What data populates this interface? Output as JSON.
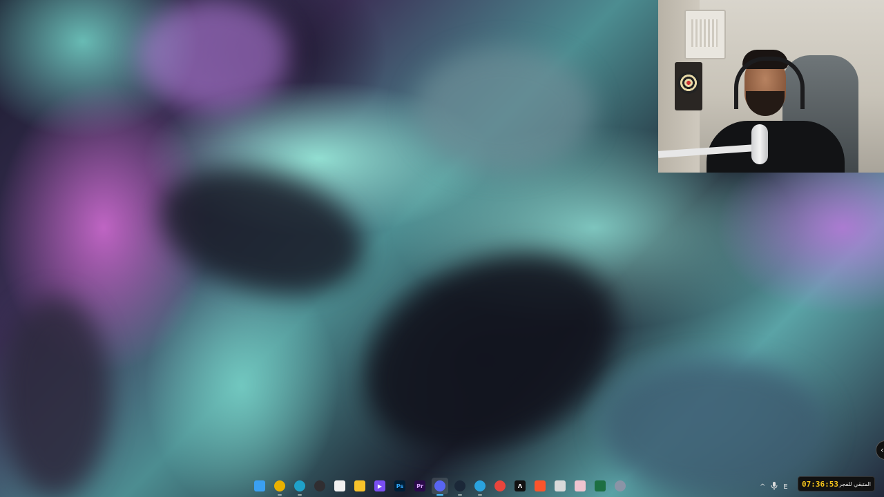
{
  "webcam": {
    "description_visible": false
  },
  "taskbar": {
    "apps": [
      {
        "name": "start",
        "icon": "windows-start-icon",
        "color": "#3aa0f2",
        "glyph": ""
      },
      {
        "name": "chrome",
        "icon": "chrome-icon",
        "color": "#e9b100",
        "glyph": ""
      },
      {
        "name": "edge",
        "icon": "edge-icon",
        "color": "#1fa1c9",
        "glyph": ""
      },
      {
        "name": "obs",
        "icon": "obs-icon",
        "color": "#302e31",
        "glyph": ""
      },
      {
        "name": "store",
        "icon": "store-icon",
        "color": "#f1f1f1",
        "glyph": ""
      },
      {
        "name": "explorer",
        "icon": "folder-icon",
        "color": "#f7c22a",
        "glyph": ""
      },
      {
        "name": "media-player",
        "icon": "play-icon",
        "color": "#7a4ff2",
        "glyph": "▶"
      },
      {
        "name": "photoshop",
        "icon": "photoshop-icon",
        "color": "#001e36",
        "glyph": "Ps"
      },
      {
        "name": "premiere",
        "icon": "premiere-icon",
        "color": "#2a0a4a",
        "glyph": "Pr"
      },
      {
        "name": "discord",
        "icon": "discord-icon",
        "color": "#5865f2",
        "glyph": ""
      },
      {
        "name": "steam",
        "icon": "steam-icon",
        "color": "#1b2838",
        "glyph": ""
      },
      {
        "name": "telegram",
        "icon": "telegram-icon",
        "color": "#2aa3de",
        "glyph": ""
      },
      {
        "name": "red-app",
        "icon": "red-app-icon",
        "color": "#e8453c",
        "glyph": ""
      },
      {
        "name": "lambda-app",
        "icon": "lambda-icon",
        "color": "#111111",
        "glyph": "Λ"
      },
      {
        "name": "brave",
        "icon": "brave-icon",
        "color": "#fb542b",
        "glyph": ""
      },
      {
        "name": "snipping-tool",
        "icon": "snipping-tool-icon",
        "color": "#d9d9d9",
        "glyph": ""
      },
      {
        "name": "image-app",
        "icon": "image-app-icon",
        "color": "#efc4cf",
        "glyph": ""
      },
      {
        "name": "excel",
        "icon": "excel-icon",
        "color": "#1d6f42",
        "glyph": ""
      },
      {
        "name": "settings",
        "icon": "settings-gear-icon",
        "color": "#8a94a6",
        "glyph": ""
      }
    ],
    "active_app": "discord"
  },
  "tray": {
    "chevron": "^",
    "mic_icon": "microphone-icon",
    "lang": "E"
  },
  "clock": {
    "time": "07:36:53",
    "label": "المتبقي للفجر"
  },
  "edge_button": {
    "glyph": "‹"
  }
}
